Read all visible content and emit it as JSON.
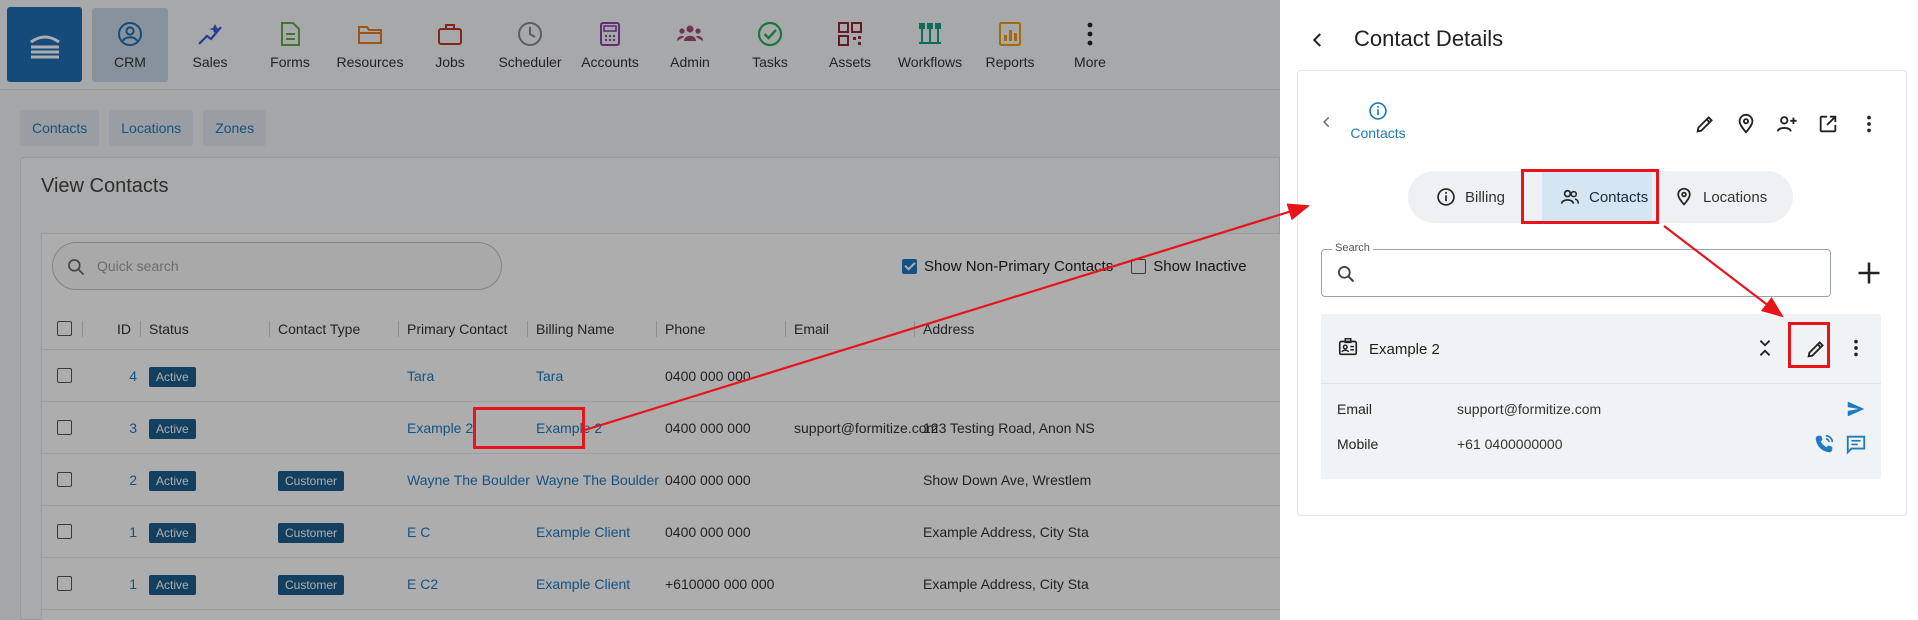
{
  "nav": {
    "items": [
      {
        "label": "CRM",
        "icon": "crm-icon",
        "color": "#1f6fb5"
      },
      {
        "label": "Sales",
        "icon": "sales-icon",
        "color": "#3b5bdb"
      },
      {
        "label": "Forms",
        "icon": "forms-icon",
        "color": "#6aa84f"
      },
      {
        "label": "Resources",
        "icon": "resources-icon",
        "color": "#e67e22"
      },
      {
        "label": "Jobs",
        "icon": "jobs-icon",
        "color": "#c0392b"
      },
      {
        "label": "Scheduler",
        "icon": "scheduler-icon",
        "color": "#7f8c8d"
      },
      {
        "label": "Accounts",
        "icon": "accounts-icon",
        "color": "#8e44ad"
      },
      {
        "label": "Admin",
        "icon": "admin-icon",
        "color": "#a64d79"
      },
      {
        "label": "Tasks",
        "icon": "tasks-icon",
        "color": "#27ae60"
      },
      {
        "label": "Assets",
        "icon": "assets-icon",
        "color": "#8e2c3a"
      },
      {
        "label": "Workflows",
        "icon": "workflows-icon",
        "color": "#16a085"
      },
      {
        "label": "Reports",
        "icon": "reports-icon",
        "color": "#f39c12"
      },
      {
        "label": "More",
        "icon": "more-icon",
        "color": "#222222"
      }
    ]
  },
  "subtabs": [
    "Contacts",
    "Locations",
    "Zones"
  ],
  "page": {
    "title": "View Contacts",
    "search_placeholder": "Quick search",
    "filter_non_primary": "Show Non-Primary Contacts",
    "filter_inactive": "Show Inactive"
  },
  "table": {
    "headers": [
      "ID",
      "Status",
      "Contact Type",
      "Primary Contact",
      "Billing Name",
      "Phone",
      "Email",
      "Address"
    ],
    "rows": [
      {
        "id": "4",
        "status": "Active",
        "type": "",
        "primary": "Tara",
        "billing": "Tara",
        "phone": "0400 000 000",
        "email": "",
        "address": ""
      },
      {
        "id": "3",
        "status": "Active",
        "type": "",
        "primary": "Example 2",
        "billing": "Example 2",
        "phone": "0400 000 000",
        "email": "support@formitize.com",
        "address": "123 Testing Road, Anon NS"
      },
      {
        "id": "2",
        "status": "Active",
        "type": "Customer",
        "primary": "Wayne The Boulder",
        "billing": "Wayne The Boulder",
        "phone": "0400 000 000",
        "email": "",
        "address": "Show Down Ave, Wrestlem"
      },
      {
        "id": "1",
        "status": "Active",
        "type": "Customer",
        "primary": "E C",
        "billing": "Example Client",
        "phone": "0400 000 000",
        "email": "",
        "address": "Example Address, City Sta"
      },
      {
        "id": "1",
        "status": "Active",
        "type": "Customer",
        "primary": "E C2",
        "billing": "Example Client",
        "phone": "+610000 000 000",
        "email": "",
        "address": "Example Address, City Sta"
      }
    ]
  },
  "drawer": {
    "title": "Contact Details",
    "crumb": "Contacts",
    "tabs": [
      "Billing",
      "Contacts",
      "Locations"
    ],
    "search_label": "Search",
    "contact": {
      "name": "Example 2",
      "email_label": "Email",
      "email": "support@formitize.com",
      "mobile_label": "Mobile",
      "mobile": "+61 0400000000"
    }
  },
  "colors": {
    "accent": "#1f7ac0",
    "highlight": "#e8141b",
    "badge": "#1d5f8e"
  }
}
